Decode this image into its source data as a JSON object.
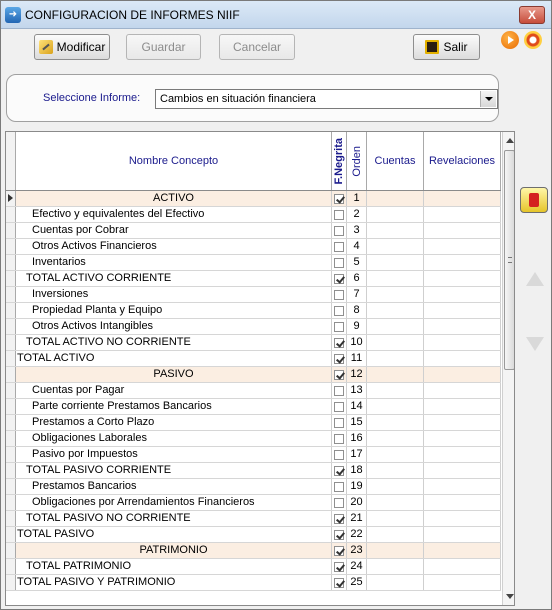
{
  "window": {
    "title": "CONFIGURACION DE INFORMES NIIF",
    "close_label": "X"
  },
  "toolbar": {
    "modificar_label": "Modificar",
    "guardar_label": "Guardar",
    "cancelar_label": "Cancelar",
    "salir_label": "Salir"
  },
  "selector": {
    "label": "Seleccione Informe:",
    "value": "Cambios en situación financiera"
  },
  "grid": {
    "columns": {
      "nombre": "Nombre Concepto",
      "negrita": "F.Negrita",
      "orden": "Orden",
      "cuentas": "Cuentas",
      "revelaciones": "Revelaciones"
    },
    "rows": [
      {
        "name": "ACTIVO",
        "indent": "center",
        "bold": true,
        "order": "1",
        "group": true
      },
      {
        "name": "Efectivo y equivalentes del Efectivo",
        "indent": 2,
        "bold": false,
        "order": "2"
      },
      {
        "name": "Cuentas por Cobrar",
        "indent": 2,
        "bold": false,
        "order": "3"
      },
      {
        "name": "Otros Activos Financieros",
        "indent": 2,
        "bold": false,
        "order": "4"
      },
      {
        "name": "Inventarios",
        "indent": 2,
        "bold": false,
        "order": "5"
      },
      {
        "name": "TOTAL ACTIVO CORRIENTE",
        "indent": 1,
        "bold": true,
        "order": "6"
      },
      {
        "name": "Inversiones",
        "indent": 2,
        "bold": false,
        "order": "7"
      },
      {
        "name": "Propiedad Planta y Equipo",
        "indent": 2,
        "bold": false,
        "order": "8"
      },
      {
        "name": "Otros Activos Intangibles",
        "indent": 2,
        "bold": false,
        "order": "9"
      },
      {
        "name": "TOTAL ACTIVO NO CORRIENTE",
        "indent": 1,
        "bold": true,
        "order": "10"
      },
      {
        "name": "TOTAL ACTIVO",
        "indent": 0,
        "bold": true,
        "order": "11"
      },
      {
        "name": "PASIVO",
        "indent": "center",
        "bold": true,
        "order": "12",
        "group": true
      },
      {
        "name": "Cuentas por Pagar",
        "indent": 2,
        "bold": false,
        "order": "13"
      },
      {
        "name": "Parte corriente Prestamos Bancarios",
        "indent": 2,
        "bold": false,
        "order": "14"
      },
      {
        "name": "Prestamos a Corto Plazo",
        "indent": 2,
        "bold": false,
        "order": "15"
      },
      {
        "name": "Obligaciones Laborales",
        "indent": 2,
        "bold": false,
        "order": "16"
      },
      {
        "name": "Pasivo por Impuestos",
        "indent": 2,
        "bold": false,
        "order": "17"
      },
      {
        "name": "TOTAL PASIVO CORRIENTE",
        "indent": 1,
        "bold": true,
        "order": "18"
      },
      {
        "name": "Prestamos Bancarios",
        "indent": 2,
        "bold": false,
        "order": "19"
      },
      {
        "name": "Obligaciones por Arrendamientos Financieros",
        "indent": 2,
        "bold": false,
        "order": "20"
      },
      {
        "name": "TOTAL PASIVO NO CORRIENTE",
        "indent": 1,
        "bold": true,
        "order": "21"
      },
      {
        "name": "TOTAL PASIVO",
        "indent": 0,
        "bold": true,
        "order": "22"
      },
      {
        "name": "PATRIMONIO",
        "indent": "center",
        "bold": true,
        "order": "23",
        "group": true
      },
      {
        "name": "TOTAL PATRIMONIO",
        "indent": 1,
        "bold": true,
        "order": "24"
      },
      {
        "name": "TOTAL PASIVO Y PATRIMONIO",
        "indent": 0,
        "bold": true,
        "order": "25"
      }
    ]
  },
  "icons": {
    "title": "app-window-icon",
    "modificar": "pencil-icon",
    "salir": "exit-door-icon",
    "play": "play-icon",
    "settings": "gear-icon",
    "side_action": "export-icon"
  }
}
